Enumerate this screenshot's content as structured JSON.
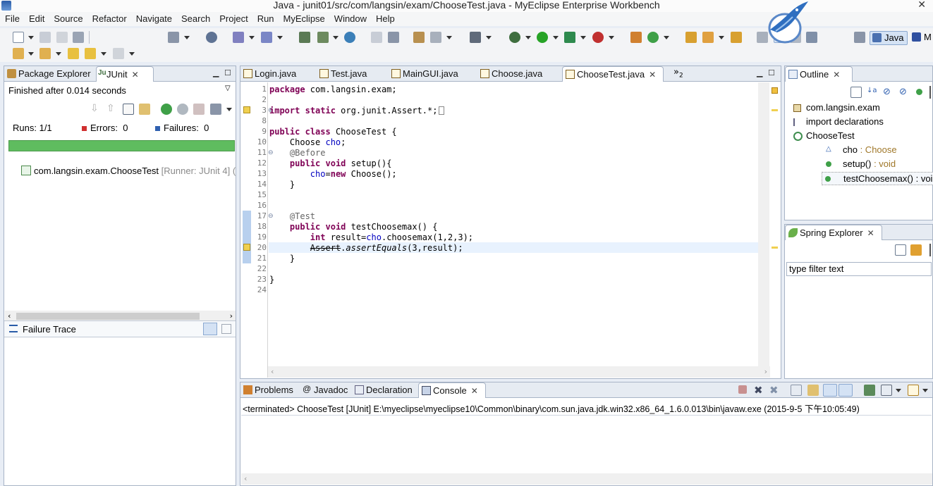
{
  "window": {
    "title": "Java - junit01/src/com/langsin/exam/ChooseTest.java - MyEclipse Enterprise Workbench"
  },
  "menu": [
    "File",
    "Edit",
    "Source",
    "Refactor",
    "Navigate",
    "Search",
    "Project",
    "Run",
    "MyEclipse",
    "Window",
    "Help"
  ],
  "perspective": {
    "label": "Java",
    "other": "M"
  },
  "left_panel": {
    "tabs": [
      {
        "label": "Package Explorer"
      },
      {
        "label": "JUnit"
      }
    ],
    "status": "Finished after 0.014 seconds",
    "runs_label": "Runs:",
    "runs_value": "1/1",
    "errors_label": "Errors:",
    "errors_value": "0",
    "failures_label": "Failures:",
    "failures_value": "0",
    "progress": 1.0,
    "progress_color": "#5fbc5f",
    "test_item": "com.langsin.exam.ChooseTest",
    "test_runner": "[Runner: JUnit 4] (",
    "failure_trace": "Failure Trace"
  },
  "editor": {
    "tabs": [
      {
        "label": "Login.java"
      },
      {
        "label": "Test.java"
      },
      {
        "label": "MainGUI.java"
      },
      {
        "label": "Choose.java"
      },
      {
        "label": "ChooseTest.java"
      }
    ],
    "overflow": "»",
    "overflow_count": "2",
    "lines": [
      {
        "no": "1",
        "text": "package com.langsin.exam;"
      },
      {
        "no": "2",
        "text": ""
      },
      {
        "no": "3",
        "text": "import static org.junit.Assert.*;"
      },
      {
        "no": "8",
        "text": ""
      },
      {
        "no": "9",
        "text": "public class ChooseTest {"
      },
      {
        "no": "10",
        "text": "    Choose cho;"
      },
      {
        "no": "11",
        "text": "    @Before"
      },
      {
        "no": "12",
        "text": "    public void setup(){"
      },
      {
        "no": "13",
        "text": "        cho=new Choose();"
      },
      {
        "no": "14",
        "text": "    }"
      },
      {
        "no": "15",
        "text": ""
      },
      {
        "no": "16",
        "text": ""
      },
      {
        "no": "17",
        "text": "    @Test"
      },
      {
        "no": "18",
        "text": "    public void testChoosemax() {"
      },
      {
        "no": "19",
        "text": "        int result=cho.choosemax(1,2,3);"
      },
      {
        "no": "20",
        "text": "        Assert.assertEquals(3,result);"
      },
      {
        "no": "21",
        "text": "    }"
      },
      {
        "no": "22",
        "text": ""
      },
      {
        "no": "23",
        "text": "}"
      },
      {
        "no": "24",
        "text": ""
      }
    ]
  },
  "outline": {
    "tab": "Outline",
    "items": [
      {
        "label": "com.langsin.exam",
        "type": ""
      },
      {
        "label": "import declarations",
        "type": ""
      },
      {
        "label": "ChooseTest",
        "type": ""
      },
      {
        "label": "cho",
        "type": " : Choose"
      },
      {
        "label": "setup()",
        "type": " : void"
      },
      {
        "label": "testChoosemax()",
        "type": " : void"
      }
    ]
  },
  "spring": {
    "tab": "Spring Explorer",
    "filter_placeholder": "type filter text"
  },
  "bottom": {
    "tabs": [
      {
        "label": "Problems"
      },
      {
        "label": "Javadoc"
      },
      {
        "label": "Declaration"
      },
      {
        "label": "Console"
      }
    ],
    "console_line": "<terminated> ChooseTest [JUnit] E:\\myeclipse\\myeclipse10\\Common\\binary\\com.sun.java.jdk.win32.x86_64_1.6.0.013\\bin\\javaw.exe (2015-9-5 下午10:05:49)"
  }
}
